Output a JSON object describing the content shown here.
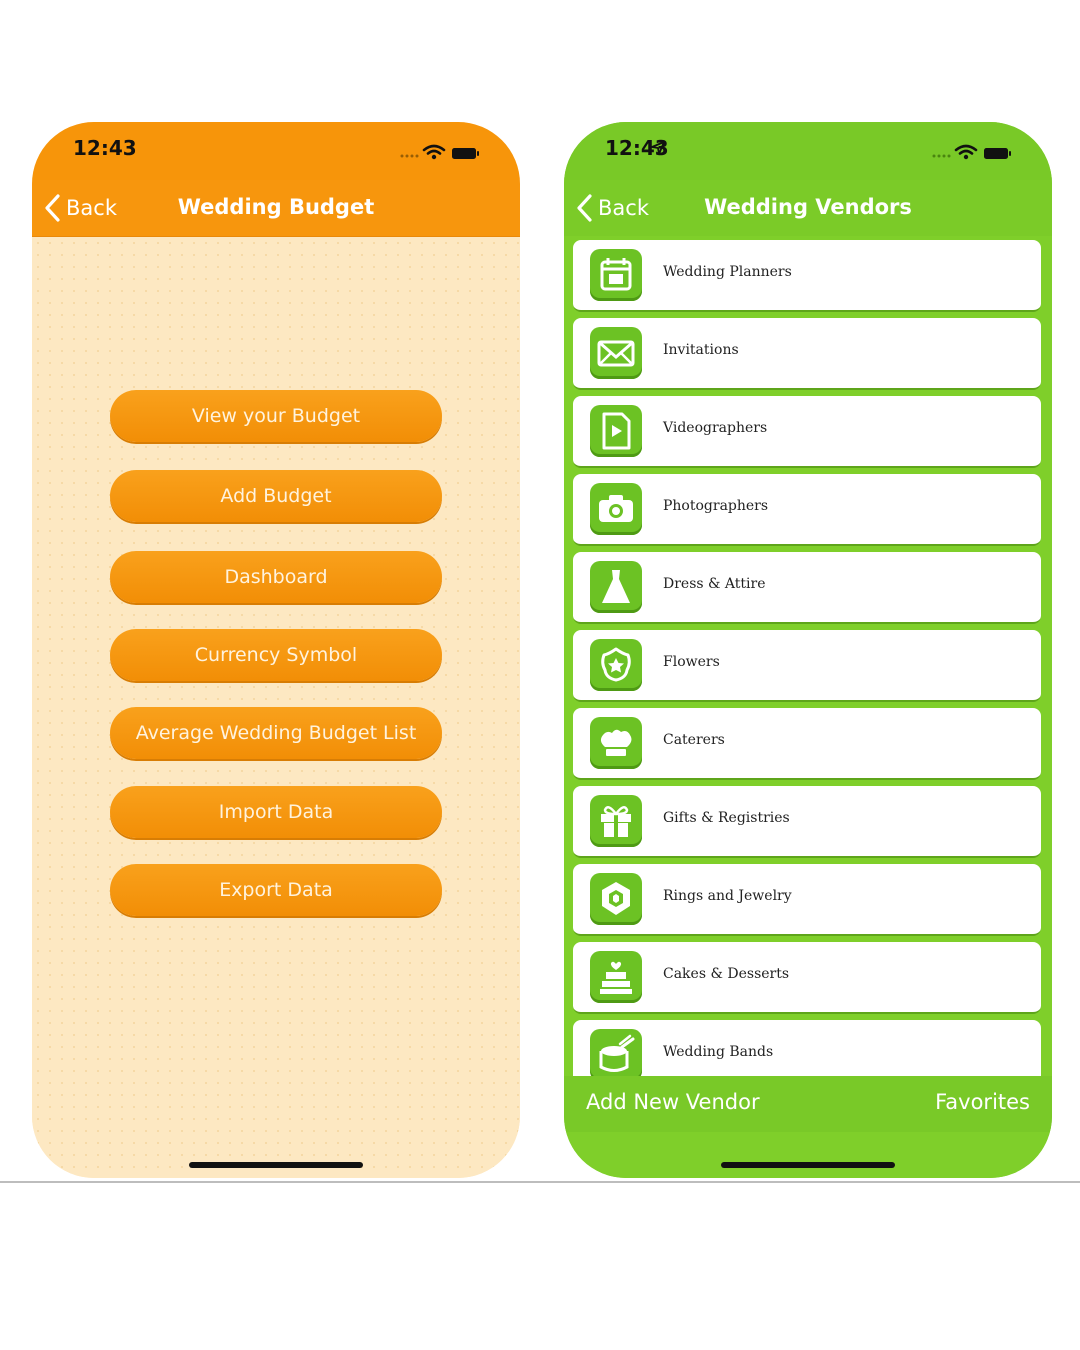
{
  "budget_screen": {
    "status": {
      "time": "12:43"
    },
    "nav": {
      "back_label": "Back",
      "title": "Wedding Budget"
    },
    "buttons": [
      "View your Budget",
      "Add Budget",
      "Dashboard",
      "Currency Symbol",
      "Average Wedding Budget List",
      "Import Data",
      "Export Data"
    ]
  },
  "vendors_screen": {
    "status": {
      "time": "12:43"
    },
    "nav": {
      "back_label": "Back",
      "title": "Wedding Vendors"
    },
    "vendors": [
      {
        "label": "Wedding Planners",
        "icon": "calendar-icon"
      },
      {
        "label": "Invitations",
        "icon": "envelope-icon"
      },
      {
        "label": "Videographers",
        "icon": "video-file-icon"
      },
      {
        "label": "Photographers",
        "icon": "camera-icon"
      },
      {
        "label": "Dress & Attire",
        "icon": "dress-icon"
      },
      {
        "label": "Flowers",
        "icon": "flower-icon"
      },
      {
        "label": "Caterers",
        "icon": "chef-hat-icon"
      },
      {
        "label": "Gifts & Registries",
        "icon": "gift-icon"
      },
      {
        "label": "Rings and Jewelry",
        "icon": "gem-icon"
      },
      {
        "label": "Cakes & Desserts",
        "icon": "cake-icon"
      },
      {
        "label": "Wedding Bands",
        "icon": "drum-icon"
      }
    ],
    "bottom_bar": {
      "add_label": "Add New Vendor",
      "favorites_label": "Favorites"
    }
  },
  "colors": {
    "budget_accent": "#f7950a",
    "budget_background": "#fde8c2",
    "vendors_accent": "#79c927"
  }
}
